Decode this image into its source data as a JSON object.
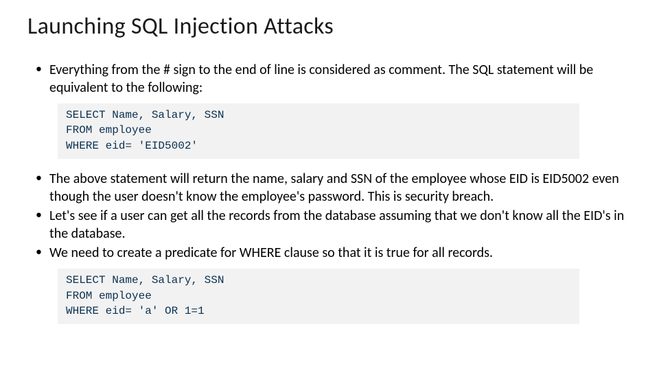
{
  "title": "Launching SQL Injection Attacks",
  "bullets1": [
    "Everything from the # sign to the end of line is considered as comment. The SQL statement will be equivalent to the following:"
  ],
  "code1": {
    "line1": "SELECT Name, Salary, SSN",
    "line2": "FROM employee",
    "line3": "WHERE eid= 'EID5002'"
  },
  "bullets2": [
    "The above statement will return the name, salary and SSN of the employee whose EID is EID5002 even though the user doesn't know the employee's password. This is security breach.",
    "Let's see if a user can get all the records from the database assuming that we don't know all the EID's in the database.",
    "We need to create a predicate for WHERE clause so that it is true for all records."
  ],
  "code2": {
    "line1": "SELECT Name, Salary, SSN",
    "line2": "FROM employee",
    "line3": "WHERE eid= 'a' OR 1=1"
  }
}
